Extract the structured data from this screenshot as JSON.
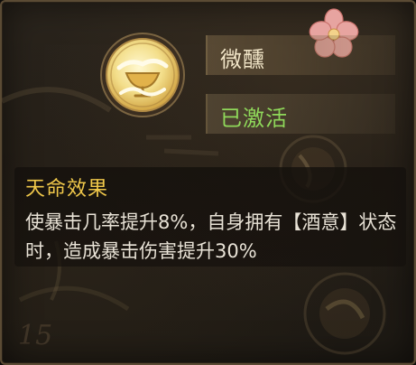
{
  "buff": {
    "name": "微醺",
    "status": "已激活",
    "icon": "wine-cup-cloud-icon"
  },
  "effect": {
    "title": "天命效果",
    "description": "使暴击几率提升8%，自身拥有【酒意】状态时，造成暴击伤害提升30%"
  },
  "colors": {
    "title_gold": "#f0c84a",
    "status_green": "#8fd85a",
    "name_text": "#f2e6c8",
    "body_text": "#e8e2d6"
  },
  "decor": {
    "background_number": "15"
  }
}
